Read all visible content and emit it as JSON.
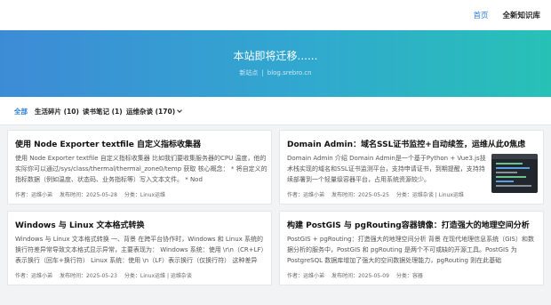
{
  "nav": {
    "home": "首页",
    "knowledge": "全新知识库"
  },
  "hero": {
    "title": "本站即将迁移......",
    "sub_left": "新站点",
    "sub_sep": "|",
    "sub_right": "blog.srebro.cn"
  },
  "tabs": [
    {
      "label": "全部"
    },
    {
      "label": "生活碎片 (10)"
    },
    {
      "label": "读书笔记 (1)"
    },
    {
      "label": "运维杂谈 (170)"
    }
  ],
  "posts": [
    {
      "title": "使用 Node Exporter textfile 自定义指标收集器",
      "excerpt": "使用 Node Exporter textfile 自定义指标收集器 比如我们要收集服务器的CPU 温度，他的实际你可以通过/sys/class/thermal/thermal_zone0/temp 获取 核心概念：  * 将自定义的指标数据（例如温度、状态码、业务指标等）写入文本文件。  * Nod",
      "author": "作者：运维小弟",
      "date": "发布时间：2025-05-28",
      "category": "分类：Linux运维"
    },
    {
      "title": "Domain Admin：域名SSL证书监控+自动续签，运维从此0焦虑",
      "excerpt": "Domain Admin 介绍 Domain Admin是一个基于Python + Vue3.js技术栈实现的域名和SSL证书监测平台，支持申请证书，到期提醒，支持持续部署到一个轻量级容器平台，占用系统资源较少。",
      "author": "作者：运维小弟",
      "date": "发布时间：2025-05-25",
      "category": "分类：运维杂谈 | Linux运维"
    },
    {
      "title": "Windows 与 Linux 文本格式转换",
      "excerpt": "Windows 与 Linux 文本格式转换 一、背景 在跨平台协作时，Windows 和 Linux 系统的换行符差异常导致文本格式显示异常，主要表现为： Windows 系统：使用 \\r\\n（CR+LF）表示换行（回车+换行符） Linux 系统：使用 \\n（LF）表示换行（仅换行符） 这种差异",
      "author": "作者：运维小弟",
      "date": "发布时间：2025-05-23",
      "category": "分类：Linux运维 | 运维杂谈"
    },
    {
      "title": "构建 PostGIS 与 pgRouting容器镜像：打造强大的地理空间分析",
      "excerpt": "PostGIS + pgRouting：打造强大的地理空间分析 背景 在现代地理信息系统（GIS）和数据分析的服务中，PostGIS 和 pgRouting 是两个不可或缺的开源工具。PostGIS 为 PostgreSQL 数据库增加了强大的空间数据处理能力，pgRouting 则在此基础",
      "author": "作者：运维小弟",
      "date": "发布时间：2025-05-09",
      "category": "分类：容器"
    }
  ],
  "thumbnail_icon": "terminal-screenshot-icon"
}
